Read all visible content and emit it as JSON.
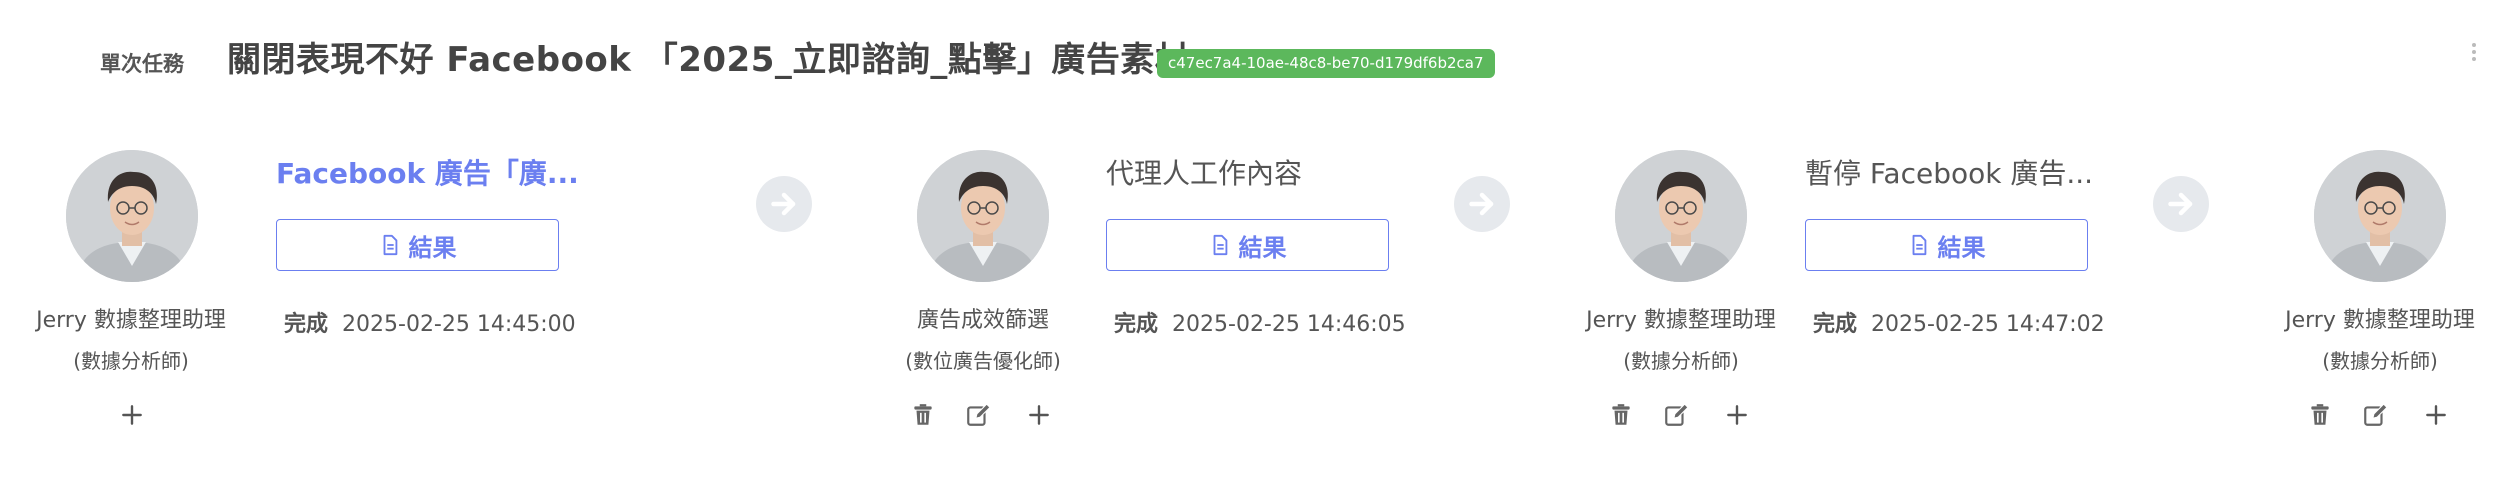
{
  "header": {
    "task_type": "單次任務",
    "title": "關閉表現不好 Facebook 「2025_立即諮詢_點擊」廣告素材",
    "task_id": "c47ec7a4-10ae-48c8-be70-d179df6b2ca7"
  },
  "colors": {
    "accent": "#6b7ff0",
    "badge": "#5cb85c",
    "arrow_bg": "#e6e9ed",
    "text": "#555555"
  },
  "steps": [
    {
      "agent_name": "Jerry 數據整理助理",
      "agent_role": "(數據分析師)",
      "job_title": "Facebook 廣告「廣...",
      "result_label": "結果",
      "status_label": "完成",
      "status_time": "2025-02-25 14:45:00"
    },
    {
      "agent_name": "廣告成效篩選",
      "agent_role": "(數位廣告優化師)",
      "job_title": "代理人工作內容",
      "result_label": "結果",
      "status_label": "完成",
      "status_time": "2025-02-25 14:46:05"
    },
    {
      "agent_name": "Jerry 數據整理助理",
      "agent_role": "(數據分析師)",
      "job_title": "暫停 Facebook 廣告...",
      "result_label": "結果",
      "status_label": "完成",
      "status_time": "2025-02-25 14:47:02"
    },
    {
      "agent_name": "Jerry 數據整理助理",
      "agent_role": "(數據分析師)"
    }
  ],
  "icons": {
    "delete": "trash-icon",
    "edit": "edit-icon",
    "add": "plus-icon",
    "result": "document-icon",
    "next": "arrow-right-icon",
    "more": "more-vertical-icon"
  }
}
